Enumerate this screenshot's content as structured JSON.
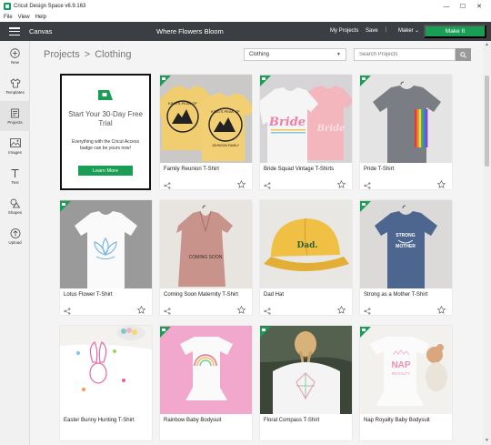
{
  "window": {
    "title": "Cricut Design Space v6.9.163",
    "minimize": "—",
    "maximize": "☐",
    "close": "✕"
  },
  "menu": [
    "File",
    "View",
    "Help"
  ],
  "header": {
    "canvas_label": "Canvas",
    "document_title": "Where Flowers Bloom",
    "my_projects": "My Projects",
    "save": "Save",
    "separator": "|",
    "machine": "Maker",
    "machine_caret": "⌄",
    "make_it": "Make It"
  },
  "sidebar": [
    {
      "label": "New",
      "icon": "plus-icon"
    },
    {
      "label": "Templates",
      "icon": "shirt-icon"
    },
    {
      "label": "Projects",
      "icon": "projects-icon"
    },
    {
      "label": "Images",
      "icon": "image-icon"
    },
    {
      "label": "Text",
      "icon": "text-icon"
    },
    {
      "label": "Shapes",
      "icon": "shapes-icon"
    },
    {
      "label": "Upload",
      "icon": "upload-icon"
    }
  ],
  "breadcrumb": {
    "root": "Projects",
    "separator": ">",
    "current": "Clothing"
  },
  "category_select": {
    "value": "Clothing",
    "caret": "▼"
  },
  "search": {
    "placeholder": "Search Projects"
  },
  "trial": {
    "headline": "Start Your 30-Day Free Trial",
    "body": "Everything with the Cricut Access badge can be yours now!",
    "button": "Learn More"
  },
  "projects": [
    "Family Reunion T-Shirt",
    "Bride Squad Vintage T-Shirts",
    "Pride T-Shirt",
    "Lotus Flower T-Shirt",
    "Coming Soon Maternity T-Shirt",
    "Dad Hat",
    "Strong as a Mother T-Shirt",
    "Easter Bunny Hunting T-Shirt",
    "Rainbow Baby Bodysuit",
    "Floral Compass T-Shirt",
    "Nap Royalty Baby Bodysuit"
  ],
  "artwork_text": {
    "family_reunion": "KING'S PEAK OF",
    "family_reunion_2": "JOHNSON FAMILY",
    "bride": "Bride",
    "dad": "Dad.",
    "strong_1": "STRONG",
    "strong_2": "MOTHER",
    "coming_soon": "COMING SOON",
    "nap": "NAP",
    "nap_2": "ROYALTY"
  },
  "colors": {
    "accent": "#1a9d55",
    "header_bg": "#3b3f44"
  }
}
